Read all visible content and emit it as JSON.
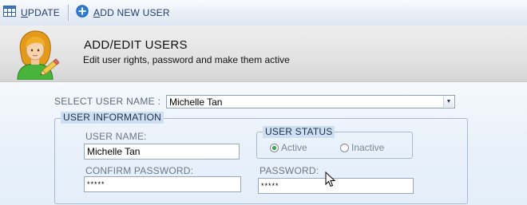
{
  "toolbar": {
    "update_label_first": "U",
    "update_label_rest": "PDATE",
    "add_label_first": "A",
    "add_label_rest": "DD NEW USER"
  },
  "header": {
    "title": "ADD/EDIT USERS",
    "subtitle": "Edit user rights, password and  make them active"
  },
  "form": {
    "select_label": "SELECT USER NAME :",
    "selected_user": "Michelle Tan",
    "group_title": "USER INFORMATION",
    "username_label": "USER NAME:",
    "username_value": "Michelle Tan",
    "confirm_password_label": "CONFIRM PASSWORD:",
    "confirm_password_value": "*****",
    "password_label": "PASSWORD:",
    "password_value": "*****",
    "status_title": "USER STATUS",
    "status_active_label": "Active",
    "status_inactive_label": "Inactive",
    "status_selected": "Active"
  },
  "colors": {
    "toolbar_text": "#1f3f6e",
    "group_title_bg": "#cfdff3",
    "radio_selected": "#3aa84a"
  },
  "icons": {
    "update": "table-grid-icon",
    "add_new_user": "plus-circle-icon",
    "header": "user-edit-avatar-icon",
    "dropdown": "chevron-down-icon",
    "cursor": "mouse-pointer-icon"
  }
}
